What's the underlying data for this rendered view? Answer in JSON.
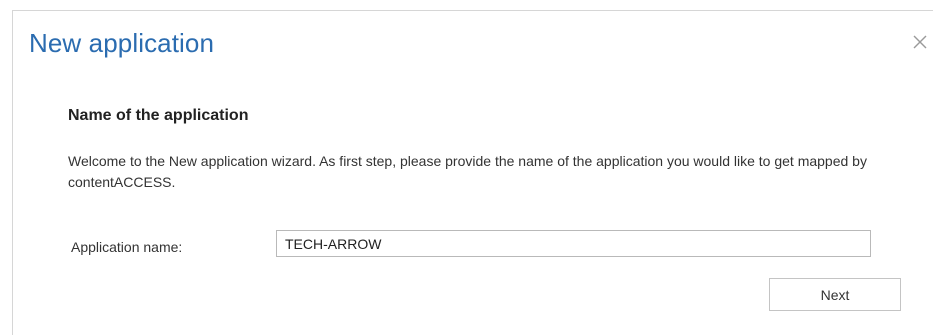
{
  "dialog": {
    "title": "New application",
    "close_icon": "close-icon"
  },
  "step": {
    "heading": "Name of the application",
    "description": "Welcome to the New application wizard. As first step, please provide the name of the application you would like to get mapped by contentACCESS."
  },
  "form": {
    "application_name_label": "Application name:",
    "application_name_value": "TECH-ARROW"
  },
  "footer": {
    "next_label": "Next"
  },
  "colors": {
    "title": "#2b6cb0",
    "border": "#d6d6d6"
  }
}
